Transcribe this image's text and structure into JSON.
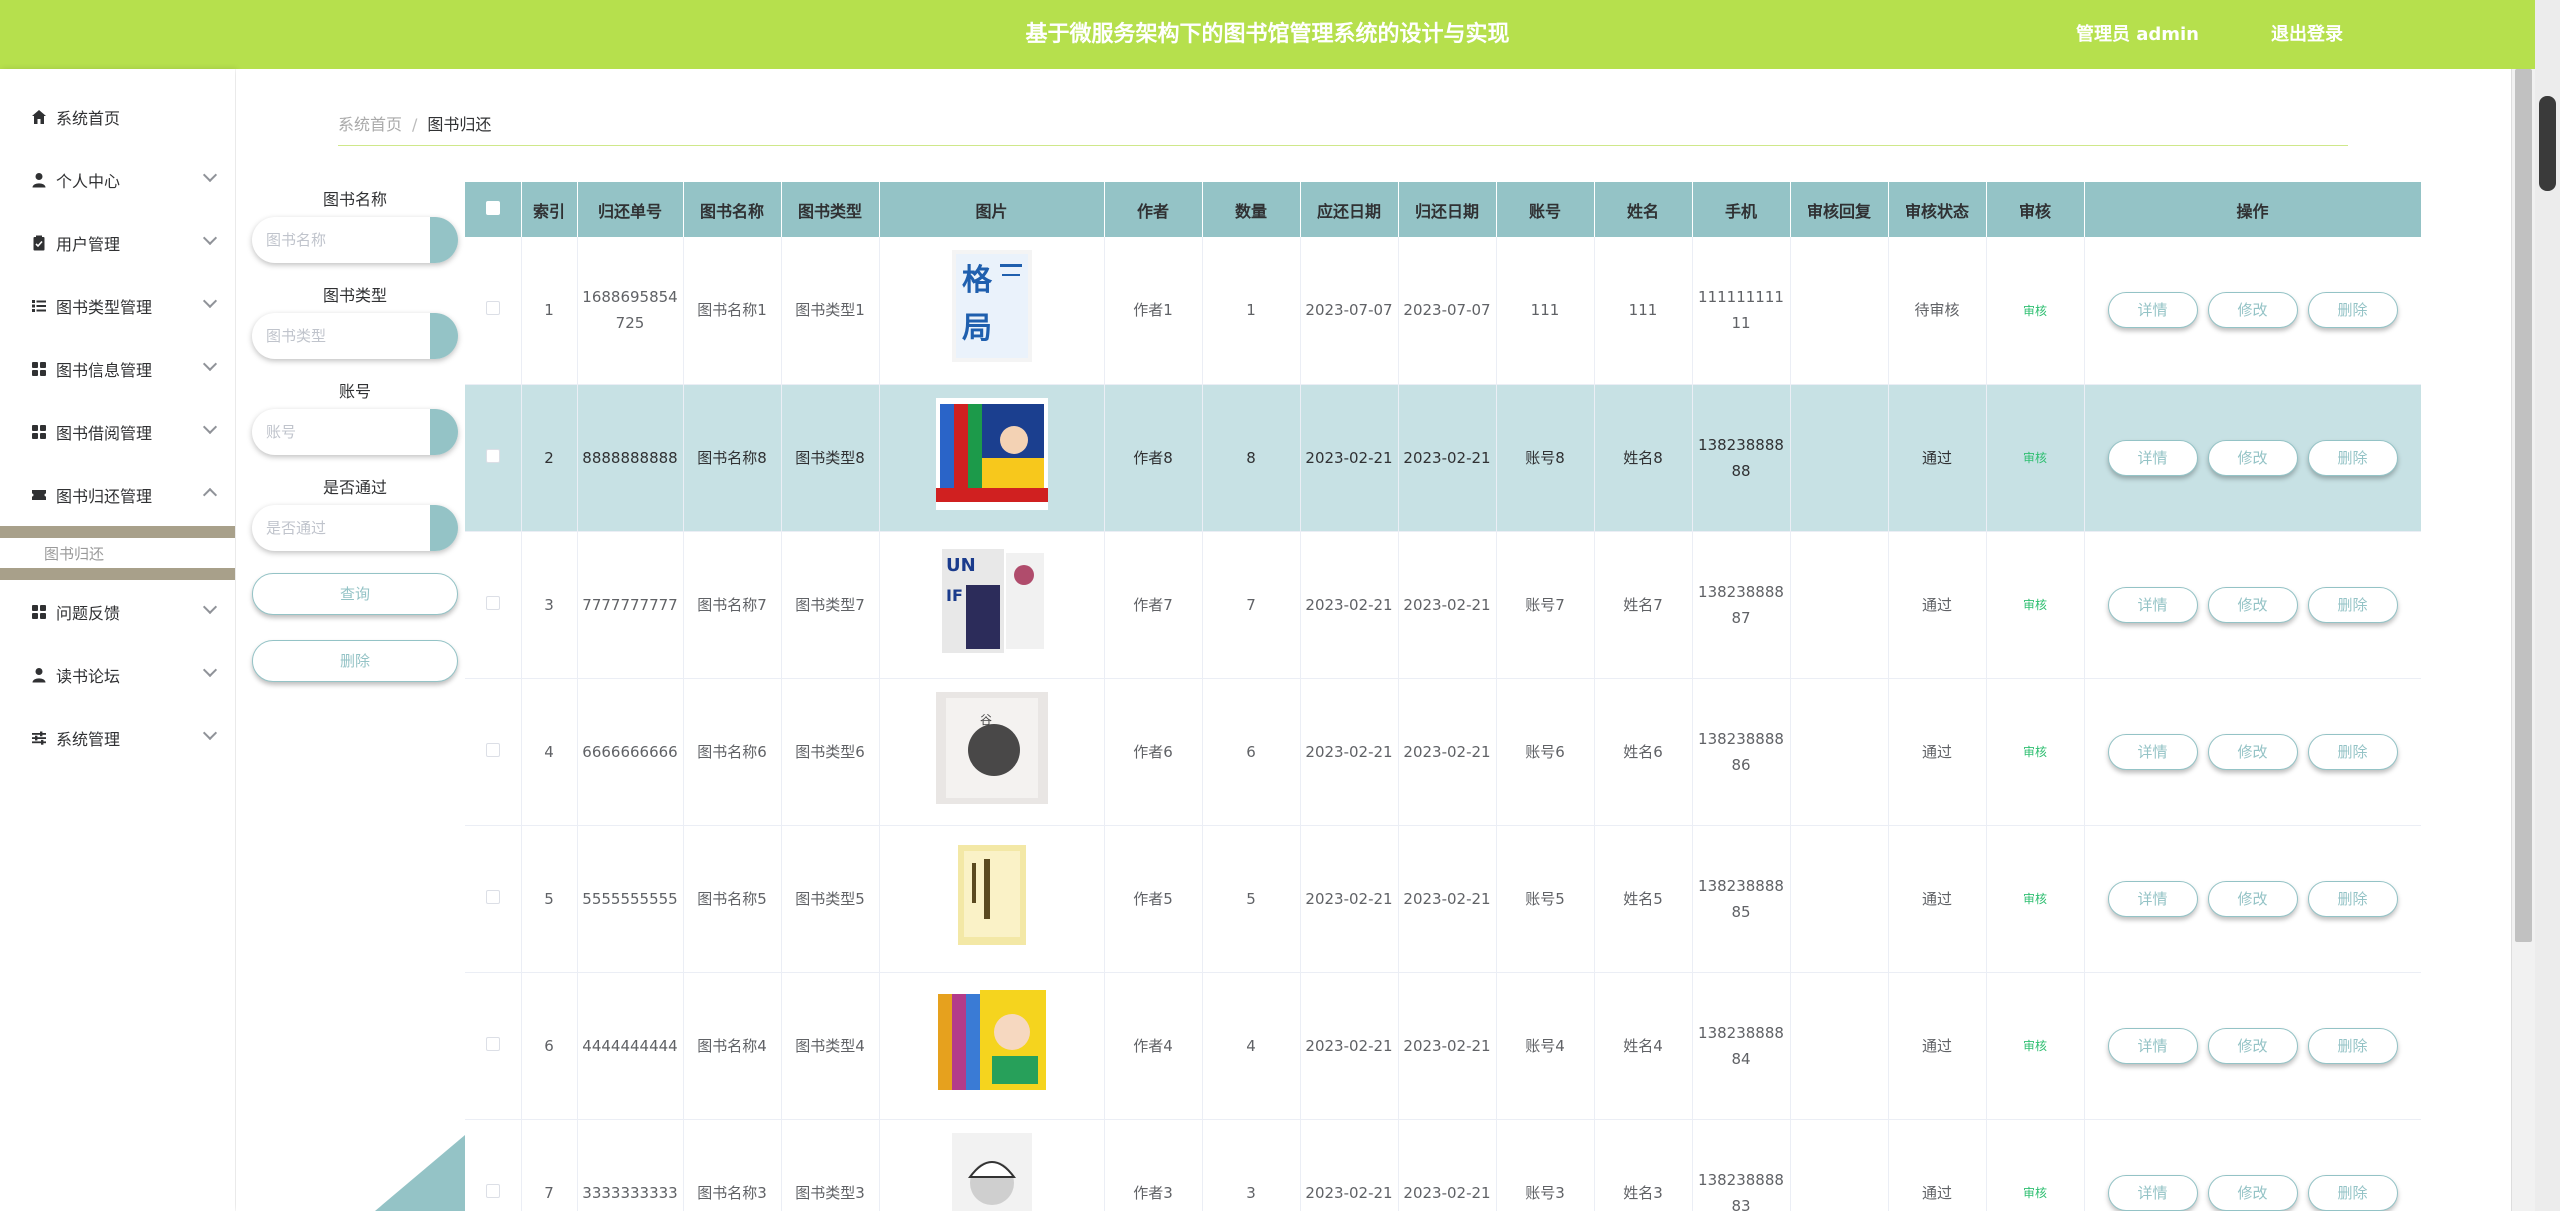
{
  "header": {
    "title": "基于微服务架构下的图书馆管理系统的设计与实现",
    "user_label": "管理员 admin",
    "logout": "退出登录"
  },
  "sidebar": {
    "items": [
      {
        "label": "系统首页",
        "icon": "home-icon"
      },
      {
        "label": "个人中心",
        "icon": "user-icon"
      },
      {
        "label": "用户管理",
        "icon": "clipboard-icon"
      },
      {
        "label": "图书类型管理",
        "icon": "list-icon"
      },
      {
        "label": "图书信息管理",
        "icon": "grid-icon"
      },
      {
        "label": "图书借阅管理",
        "icon": "grid-icon"
      },
      {
        "label": "图书归还管理",
        "icon": "ticket-icon"
      },
      {
        "label": "问题反馈",
        "icon": "grid-icon"
      },
      {
        "label": "读书论坛",
        "icon": "user-icon"
      },
      {
        "label": "系统管理",
        "icon": "sliders-icon"
      }
    ],
    "sub_item": "图书归还"
  },
  "breadcrumb": {
    "home": "系统首页",
    "separator": "/",
    "current": "图书归还"
  },
  "search": {
    "book_name_label": "图书名称",
    "book_name_placeholder": "图书名称",
    "book_type_label": "图书类型",
    "book_type_placeholder": "图书类型",
    "account_label": "账号",
    "account_placeholder": "账号",
    "pass_label": "是否通过",
    "pass_placeholder": "是否通过",
    "query_button": "查询",
    "delete_button": "删除"
  },
  "table": {
    "headers": [
      "索引",
      "归还单号",
      "图书名称",
      "图书类型",
      "图片",
      "作者",
      "数量",
      "应还日期",
      "归还日期",
      "账号",
      "姓名",
      "手机",
      "审核回复",
      "审核状态",
      "审核",
      "操作"
    ],
    "actions": {
      "detail": "详情",
      "edit": "修改",
      "delete": "删除"
    },
    "rows": [
      {
        "index": "1",
        "order_no": "1688695854725",
        "name": "图书名称1",
        "type": "图书类型1",
        "author": "作者1",
        "qty": "1",
        "due": "2023-07-07",
        "returned": "2023-07-07",
        "account": "111",
        "person": "111",
        "phone": "11111111111",
        "reply": "",
        "status": "待审核",
        "audit": "审核"
      },
      {
        "index": "2",
        "order_no": "8888888888",
        "name": "图书名称8",
        "type": "图书类型8",
        "author": "作者8",
        "qty": "8",
        "due": "2023-02-21",
        "returned": "2023-02-21",
        "account": "账号8",
        "person": "姓名8",
        "phone": "13823888888",
        "reply": "",
        "status": "通过",
        "audit": "审核"
      },
      {
        "index": "3",
        "order_no": "7777777777",
        "name": "图书名称7",
        "type": "图书类型7",
        "author": "作者7",
        "qty": "7",
        "due": "2023-02-21",
        "returned": "2023-02-21",
        "account": "账号7",
        "person": "姓名7",
        "phone": "13823888887",
        "reply": "",
        "status": "通过",
        "audit": "审核"
      },
      {
        "index": "4",
        "order_no": "6666666666",
        "name": "图书名称6",
        "type": "图书类型6",
        "author": "作者6",
        "qty": "6",
        "due": "2023-02-21",
        "returned": "2023-02-21",
        "account": "账号6",
        "person": "姓名6",
        "phone": "13823888886",
        "reply": "",
        "status": "通过",
        "audit": "审核"
      },
      {
        "index": "5",
        "order_no": "5555555555",
        "name": "图书名称5",
        "type": "图书类型5",
        "author": "作者5",
        "qty": "5",
        "due": "2023-02-21",
        "returned": "2023-02-21",
        "account": "账号5",
        "person": "姓名5",
        "phone": "13823888885",
        "reply": "",
        "status": "通过",
        "audit": "审核"
      },
      {
        "index": "6",
        "order_no": "4444444444",
        "name": "图书名称4",
        "type": "图书类型4",
        "author": "作者4",
        "qty": "4",
        "due": "2023-02-21",
        "returned": "2023-02-21",
        "account": "账号4",
        "person": "姓名4",
        "phone": "13823888884",
        "reply": "",
        "status": "通过",
        "audit": "审核"
      },
      {
        "index": "7",
        "order_no": "3333333333",
        "name": "图书名称3",
        "type": "图书类型3",
        "author": "作者3",
        "qty": "3",
        "due": "2023-02-21",
        "returned": "2023-02-21",
        "account": "账号3",
        "person": "姓名3",
        "phone": "13823888883",
        "reply": "",
        "status": "通过",
        "audit": "审核"
      }
    ]
  },
  "colors": {
    "accent": "#b6e04d",
    "teal": "#94c3c6",
    "highlight_row": "#c7e1e4",
    "audit_green": "#2fbf71"
  }
}
